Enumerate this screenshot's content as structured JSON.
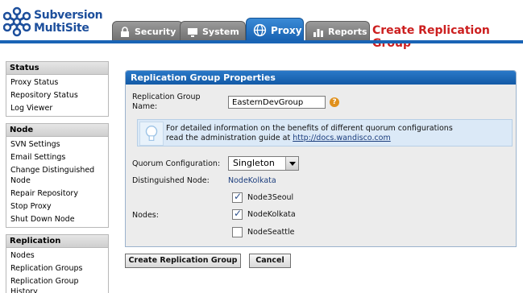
{
  "app": {
    "logo_line1": "Subversion",
    "logo_line2": "MultiSite",
    "brand_color": "#1d4f9c"
  },
  "tabs": [
    {
      "label": "Security",
      "icon": "lock-icon",
      "active": false
    },
    {
      "label": "System",
      "icon": "monitor-icon",
      "active": false
    },
    {
      "label": "Proxy",
      "icon": "globe-icon",
      "active": true
    },
    {
      "label": "Reports",
      "icon": "bar-chart-icon",
      "active": false
    }
  ],
  "page_title": "Create Replication Group",
  "sidebar": {
    "status": {
      "title": "Status",
      "items": [
        "Proxy Status",
        "Repository Status",
        "Log Viewer"
      ]
    },
    "node": {
      "title": "Node",
      "items": [
        "SVN Settings",
        "Email Settings",
        "Change Distinguished Node",
        "Repair Repository",
        "Stop Proxy",
        "Shut Down Node"
      ]
    },
    "replication": {
      "title": "Replication",
      "items": [
        "Nodes",
        "Replication Groups",
        "Replication Group History"
      ]
    }
  },
  "panel": {
    "title": "Replication Group Properties",
    "name_label": "Replication Group Name:",
    "name_value": "EasternDevGroup",
    "help_glyph": "?",
    "info_line1": "For detailed information on the benefits of different quorum configurations",
    "info_line2_prefix": "read the administration guide at ",
    "info_link": "http://docs.wandisco.com",
    "quorum_label": "Quorum Configuration:",
    "quorum_value": "Singleton",
    "dist_label": "Distinguished Node:",
    "dist_value": "NodeKolkata",
    "nodes_label": "Nodes:",
    "nodes": [
      {
        "label": "Node3Seoul",
        "checked": true
      },
      {
        "label": "NodeKolkata",
        "checked": true
      },
      {
        "label": "NodeSeattle",
        "checked": false
      }
    ]
  },
  "buttons": {
    "create": "Create Replication Group",
    "cancel": "Cancel"
  },
  "colors": {
    "accent_blue": "#1a64b5",
    "title_red": "#cc1f1f"
  }
}
